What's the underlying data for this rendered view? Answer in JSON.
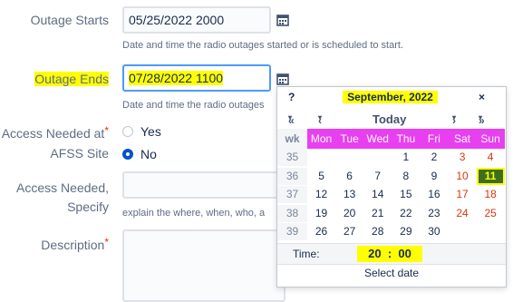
{
  "fields": {
    "outage_starts": {
      "label": "Outage Starts",
      "value": "05/25/2022 2000",
      "help": "Date and time the radio outages started or is scheduled to start."
    },
    "outage_ends": {
      "label": "Outage Ends",
      "value": "07/28/2022 1100",
      "help": "Date and time the radio outages"
    },
    "access_needed": {
      "label_line1": "Access Needed at",
      "label_line2": "AFSS Site",
      "required_mark": "*",
      "options": [
        "Yes",
        "No"
      ],
      "selected": "No"
    },
    "access_specify": {
      "label_line1": "Access Needed,",
      "label_line2": "Specify",
      "help": "explain the where, when, who, a"
    },
    "description": {
      "label": "Description",
      "required_mark": "*"
    }
  },
  "calendar": {
    "help": "?",
    "title": "September, 2022",
    "close": "×",
    "nav": {
      "prev_year": "«",
      "prev_month": "‹",
      "today": "Today",
      "next_month": "›",
      "next_year": "»",
      "dropdown": "▾"
    },
    "wk_header": "wk",
    "day_headers": [
      "Mon",
      "Tue",
      "Wed",
      "Thu",
      "Fri",
      "Sat",
      "Sun"
    ],
    "weeks": [
      {
        "wk": "35",
        "days": [
          "",
          "",
          "",
          "1",
          "2",
          "3",
          "4"
        ]
      },
      {
        "wk": "36",
        "days": [
          "5",
          "6",
          "7",
          "8",
          "9",
          "10",
          "11"
        ]
      },
      {
        "wk": "37",
        "days": [
          "12",
          "13",
          "14",
          "15",
          "16",
          "17",
          "18"
        ]
      },
      {
        "wk": "38",
        "days": [
          "19",
          "20",
          "21",
          "22",
          "23",
          "24",
          "25"
        ]
      },
      {
        "wk": "39",
        "days": [
          "26",
          "27",
          "28",
          "29",
          "30",
          "",
          ""
        ]
      }
    ],
    "selected_day": "11",
    "time_label": "Time:",
    "time_hour": "20",
    "time_sep": ":",
    "time_min": "00",
    "select_date": "Select date"
  },
  "colors": {
    "day_header_bg": "#e83ff0",
    "highlight": "#ffff00",
    "selected_bg": "#3d6e1f",
    "focus_border": "#4c9aff",
    "weekend_text": "#de350b"
  }
}
